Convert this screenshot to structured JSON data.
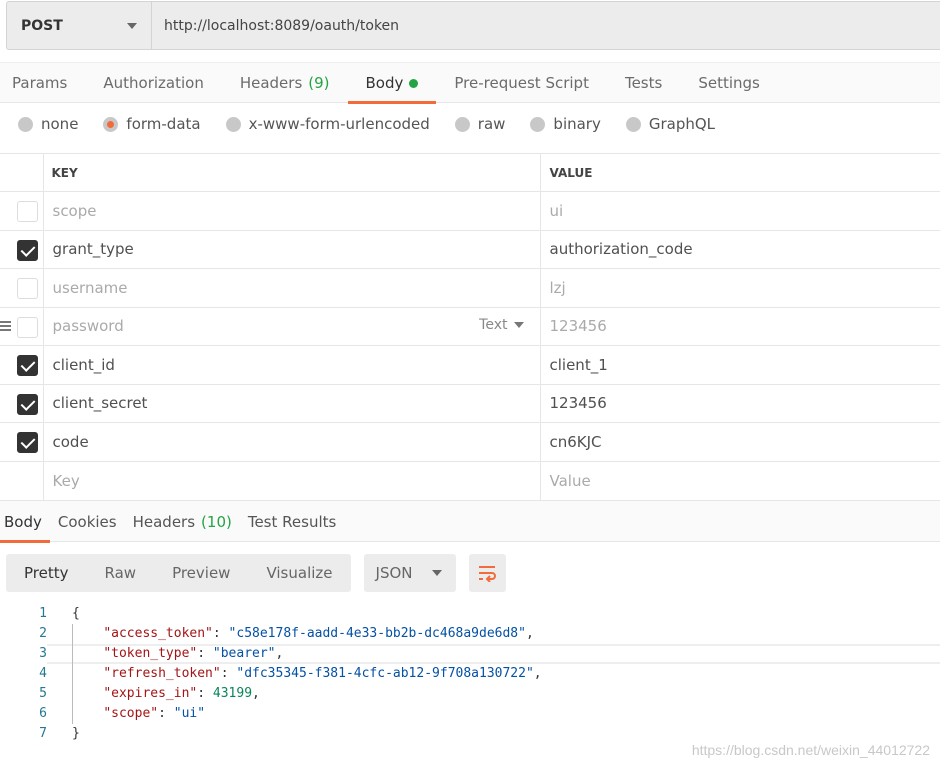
{
  "request": {
    "method": "POST",
    "url": "http://localhost:8089/oauth/token"
  },
  "request_tabs": [
    {
      "label": "Params"
    },
    {
      "label": "Authorization"
    },
    {
      "label": "Headers",
      "count": "(9)"
    },
    {
      "label": "Body",
      "active": true
    },
    {
      "label": "Pre-request Script"
    },
    {
      "label": "Tests"
    },
    {
      "label": "Settings"
    }
  ],
  "body_types": [
    {
      "label": "none"
    },
    {
      "label": "form-data",
      "selected": true
    },
    {
      "label": "x-www-form-urlencoded"
    },
    {
      "label": "raw"
    },
    {
      "label": "binary"
    },
    {
      "label": "GraphQL"
    }
  ],
  "table": {
    "headers": {
      "key": "KEY",
      "value": "VALUE"
    },
    "rows": [
      {
        "key": "scope",
        "value": "ui",
        "checked": false
      },
      {
        "key": "grant_type",
        "value": "authorization_code",
        "checked": true
      },
      {
        "key": "username",
        "value": "lzj",
        "checked": false
      },
      {
        "key": "password",
        "value": "123456",
        "checked": false,
        "type": "Text"
      },
      {
        "key": "client_id",
        "value": "client_1",
        "checked": true
      },
      {
        "key": "client_secret",
        "value": "123456",
        "checked": true
      },
      {
        "key": "code",
        "value": "cn6KJC",
        "checked": true
      }
    ],
    "placeholder": {
      "key": "Key",
      "value": "Value"
    }
  },
  "response_tabs": [
    {
      "label": "Body",
      "active": true
    },
    {
      "label": "Cookies"
    },
    {
      "label": "Headers",
      "count": "(10)"
    },
    {
      "label": "Test Results"
    }
  ],
  "view_modes": [
    "Pretty",
    "Raw",
    "Preview",
    "Visualize"
  ],
  "format": "JSON",
  "response_json": [
    {
      "n": "1",
      "text": "{"
    },
    {
      "n": "2",
      "k": "\"access_token\"",
      "v": "\"c58e178f-aadd-4e33-bb2b-dc468a9de6d8\"",
      "c": ","
    },
    {
      "n": "3",
      "k": "\"token_type\"",
      "v": "\"bearer\"",
      "c": ","
    },
    {
      "n": "4",
      "k": "\"refresh_token\"",
      "v": "\"dfc35345-f381-4cfc-ab12-9f708a130722\"",
      "c": ","
    },
    {
      "n": "5",
      "k": "\"expires_in\"",
      "num": "43199",
      "c": ","
    },
    {
      "n": "6",
      "k": "\"scope\"",
      "v": "\"ui\"",
      "c": ""
    },
    {
      "n": "7",
      "text": "}"
    }
  ],
  "watermark": "https://blog.csdn.net/weixin_44012722",
  "colors": {
    "accent": "#f26b3a",
    "success": "#26a344"
  }
}
